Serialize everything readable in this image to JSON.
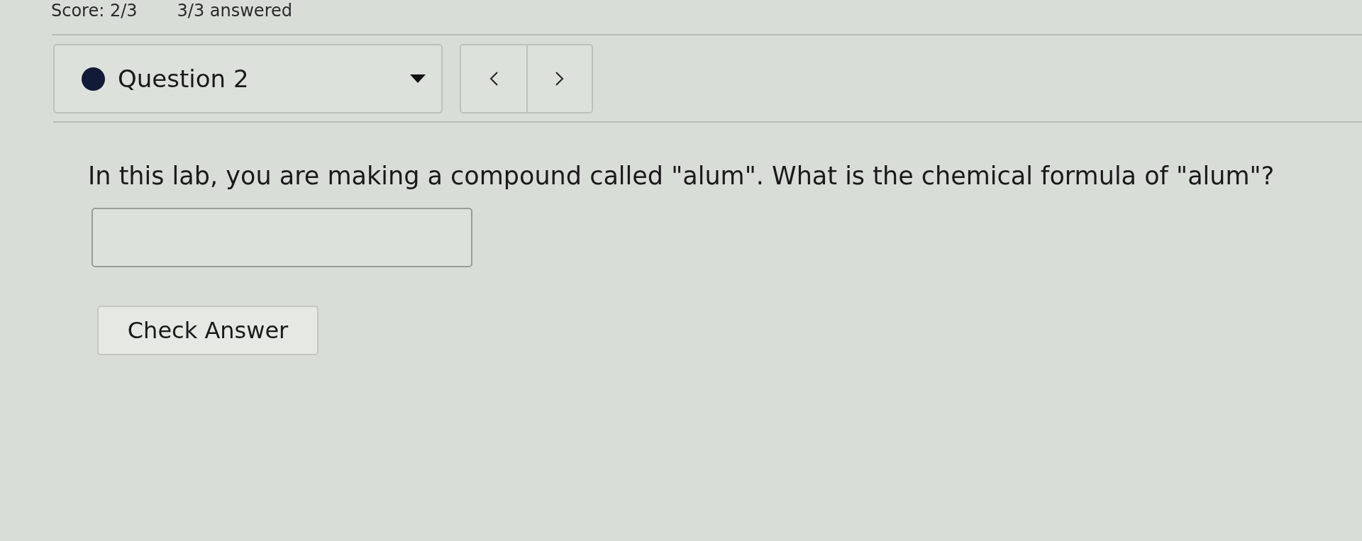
{
  "header": {
    "score": "Score: 2/3",
    "progress": "3/3 answered"
  },
  "question_nav": {
    "label": "Question 2"
  },
  "question": {
    "text": "In this lab, you are making a compound called \"alum\". What is the chemical formula of \"alum\"?"
  },
  "check_button": {
    "label": "Check Answer"
  }
}
